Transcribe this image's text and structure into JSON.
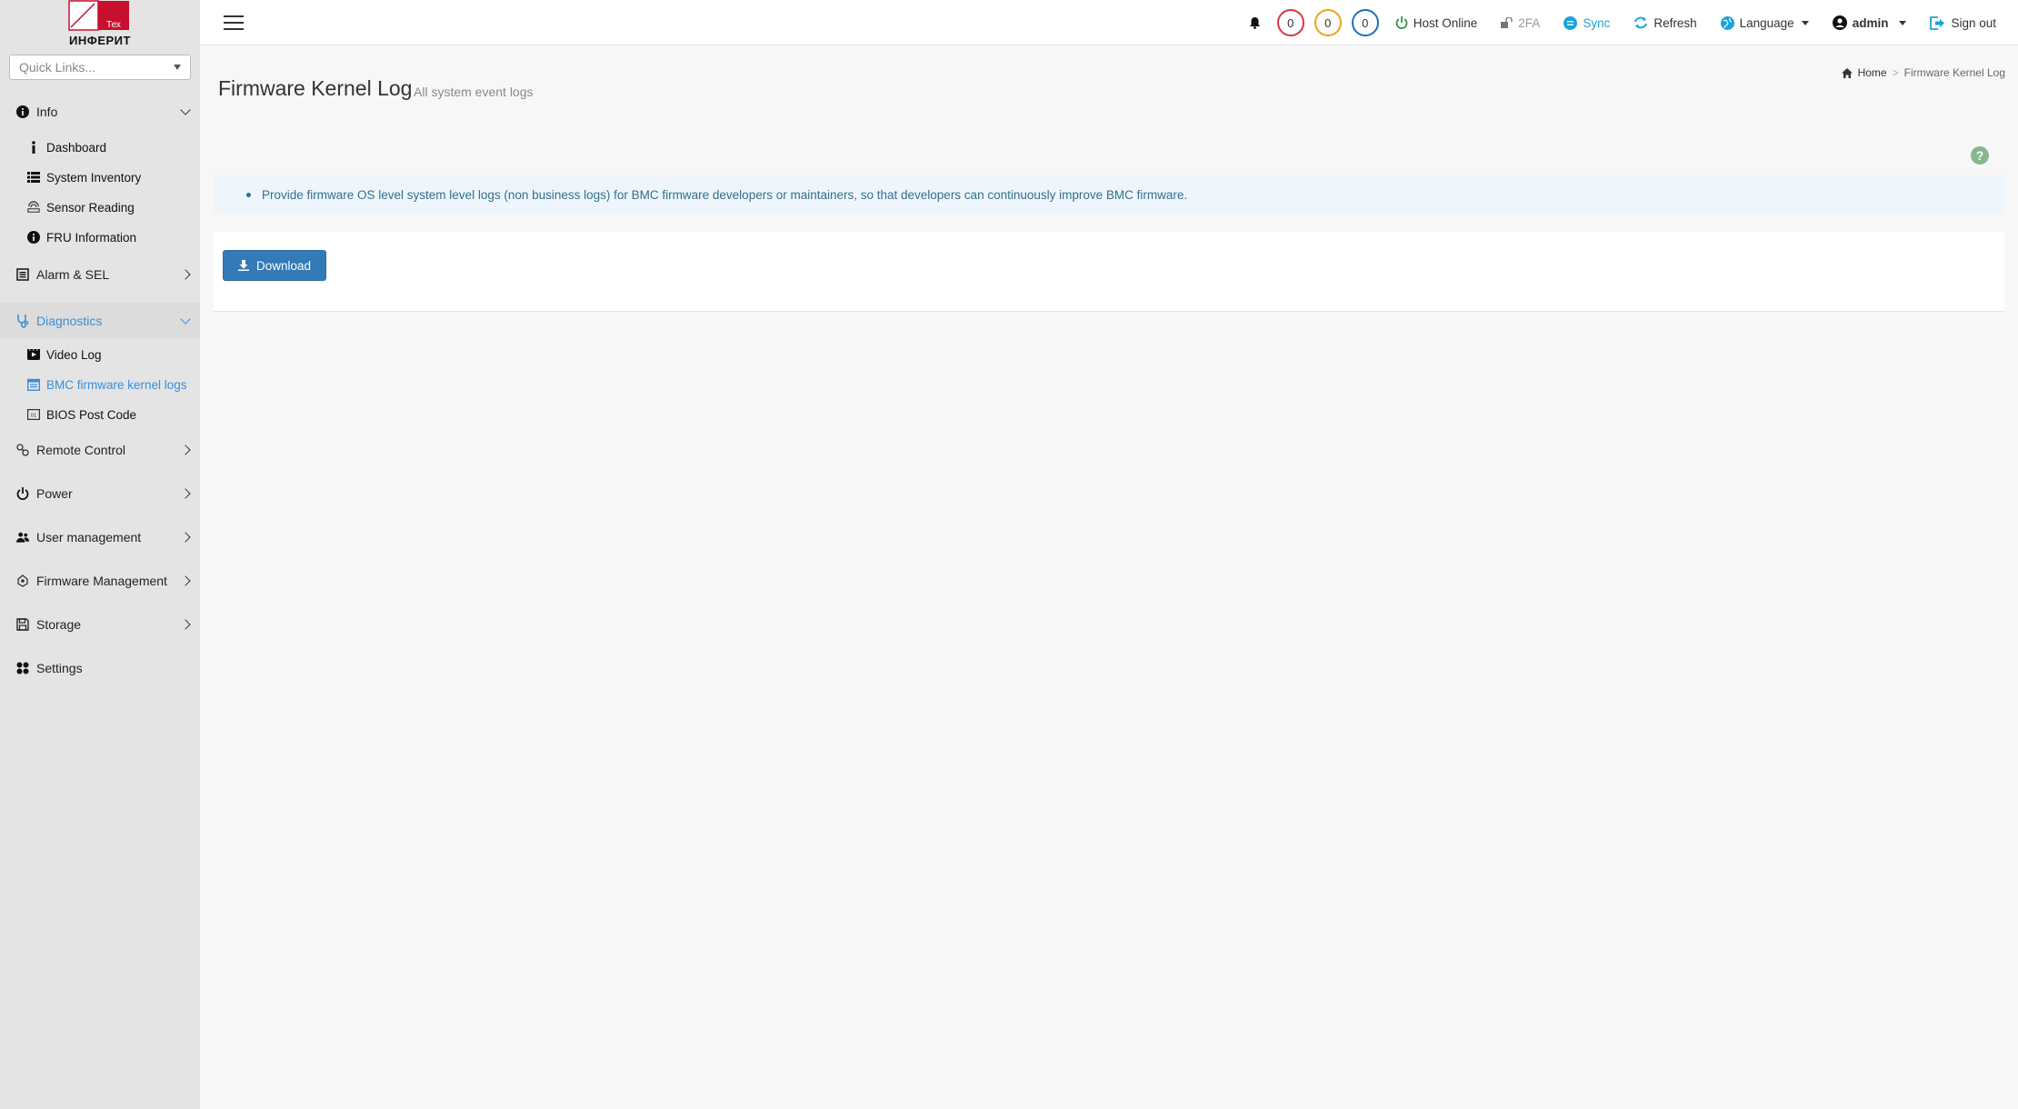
{
  "logo": {
    "brand": "ИНФЕРИТ",
    "sub": "Тех"
  },
  "quick_links": {
    "placeholder": "Quick Links..."
  },
  "sidebar": {
    "groups": [
      {
        "label": "Info",
        "expanded": true,
        "items": [
          "Dashboard",
          "System Inventory",
          "Sensor Reading",
          "FRU Information"
        ]
      },
      {
        "label": "Alarm & SEL",
        "expanded": false
      },
      {
        "label": "Diagnostics",
        "expanded": true,
        "active": true,
        "items": [
          "Video Log",
          "BMC firmware kernel logs",
          "BIOS Post Code"
        ]
      },
      {
        "label": "Remote Control",
        "expanded": false
      },
      {
        "label": "Power",
        "expanded": false
      },
      {
        "label": "User management",
        "expanded": false
      },
      {
        "label": "Firmware Management",
        "expanded": false
      },
      {
        "label": "Storage",
        "expanded": false
      },
      {
        "label": "Settings",
        "expanded": false
      }
    ]
  },
  "topbar": {
    "counts": {
      "critical": "0",
      "warning": "0",
      "info": "0"
    },
    "host_status": "Host Online",
    "twofa": "2FA",
    "sync": "Sync",
    "refresh": "Refresh",
    "language": "Language",
    "user": "admin",
    "signout": "Sign out"
  },
  "page": {
    "title": "Firmware Kernel Log",
    "subtitle": "All system event logs",
    "breadcrumb_home": "Home",
    "breadcrumb_current": "Firmware Kernel Log",
    "info_text": "Provide firmware OS level system level logs (non business logs) for BMC firmware developers or maintainers, so that developers can continuously improve BMC firmware.",
    "download_label": "Download"
  },
  "colors": {
    "accent": "#3a8fd8",
    "button": "#337ab7",
    "critical": "#d9363e",
    "warning": "#f0a21b",
    "info": "#1e6fbf",
    "online": "#2e8b3a"
  }
}
